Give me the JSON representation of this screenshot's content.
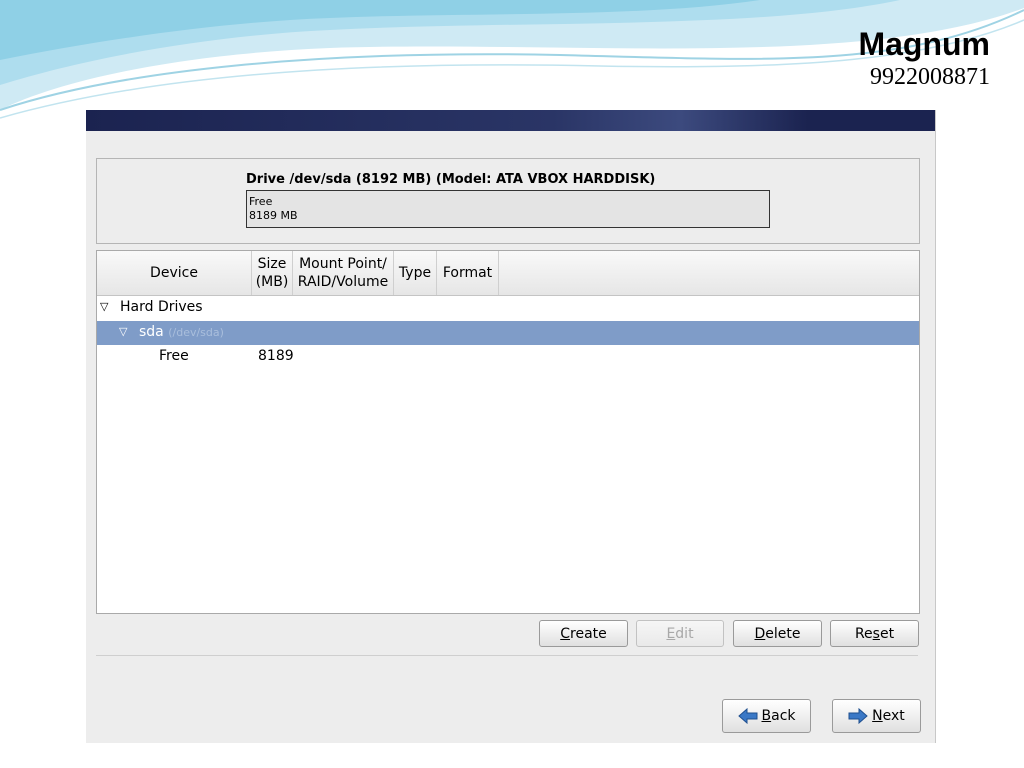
{
  "branding": {
    "name": "Magnum",
    "phone": "9922008871"
  },
  "drive": {
    "title": "Drive /dev/sda (8192 MB) (Model: ATA VBOX HARDDISK)",
    "segment_label": "Free",
    "segment_size": "8189 MB"
  },
  "columns": {
    "device": "Device",
    "size_line1": "Size",
    "size_line2": "(MB)",
    "mount_line1": "Mount Point/",
    "mount_line2": "RAID/Volume",
    "type": "Type",
    "format": "Format"
  },
  "tree": {
    "group": "Hard Drives",
    "disk_name": "sda",
    "disk_path": "(/dev/sda)",
    "free_label": "Free",
    "free_size": "8189"
  },
  "actions": {
    "create": "Create",
    "edit": "Edit",
    "delete": "Delete",
    "reset": "Reset"
  },
  "nav": {
    "back": "Back",
    "next": "Next"
  },
  "colors": {
    "selection": "#7f9cc8",
    "titlebar": "#1b2350",
    "arrow": "#3a78c6"
  }
}
